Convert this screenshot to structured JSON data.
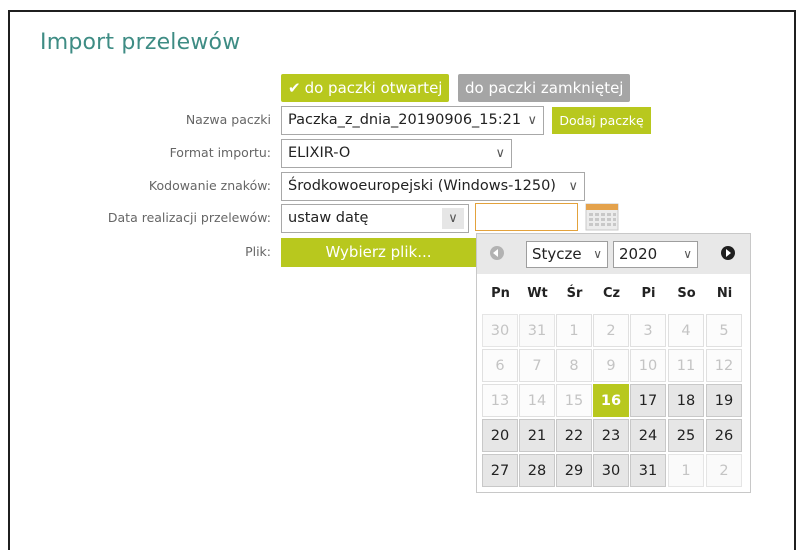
{
  "page": {
    "title": "Import przelewów"
  },
  "target": {
    "open_label": "do paczki otwartej",
    "closed_label": "do paczki zamkniętej",
    "selected": "open"
  },
  "form": {
    "package_name": {
      "label": "Nazwa paczki",
      "value": "Paczka_z_dnia_20190906_15:21",
      "add_label": "Dodaj paczkę"
    },
    "import_format": {
      "label": "Format importu:",
      "value": "ELIXIR-O"
    },
    "encoding": {
      "label": "Kodowanie znaków:",
      "value": "Środkowoeuropejski (Windows-1250)"
    },
    "execution_date": {
      "label": "Data realizacji przelewów:",
      "mode_value": "ustaw datę",
      "date_value": ""
    },
    "file": {
      "label": "Plik:",
      "button_label": "Wybierz plik..."
    }
  },
  "calendar": {
    "month": "Stycze",
    "year": "2020",
    "weekdays": [
      "Pn",
      "Wt",
      "Śr",
      "Cz",
      "Pi",
      "So",
      "Ni"
    ],
    "weeks": [
      [
        {
          "d": "30",
          "s": "off"
        },
        {
          "d": "31",
          "s": "off"
        },
        {
          "d": "1",
          "s": "past"
        },
        {
          "d": "2",
          "s": "past"
        },
        {
          "d": "3",
          "s": "past"
        },
        {
          "d": "4",
          "s": "past"
        },
        {
          "d": "5",
          "s": "past"
        }
      ],
      [
        {
          "d": "6",
          "s": "past"
        },
        {
          "d": "7",
          "s": "past"
        },
        {
          "d": "8",
          "s": "past"
        },
        {
          "d": "9",
          "s": "past"
        },
        {
          "d": "10",
          "s": "past"
        },
        {
          "d": "11",
          "s": "past"
        },
        {
          "d": "12",
          "s": "past"
        }
      ],
      [
        {
          "d": "13",
          "s": "past"
        },
        {
          "d": "14",
          "s": "past"
        },
        {
          "d": "15",
          "s": "past"
        },
        {
          "d": "16",
          "s": "today"
        },
        {
          "d": "17",
          "s": "act"
        },
        {
          "d": "18",
          "s": "act"
        },
        {
          "d": "19",
          "s": "act"
        }
      ],
      [
        {
          "d": "20",
          "s": "act"
        },
        {
          "d": "21",
          "s": "act"
        },
        {
          "d": "22",
          "s": "act"
        },
        {
          "d": "23",
          "s": "act"
        },
        {
          "d": "24",
          "s": "act"
        },
        {
          "d": "25",
          "s": "act"
        },
        {
          "d": "26",
          "s": "act"
        }
      ],
      [
        {
          "d": "27",
          "s": "act"
        },
        {
          "d": "28",
          "s": "act"
        },
        {
          "d": "29",
          "s": "act"
        },
        {
          "d": "30",
          "s": "act"
        },
        {
          "d": "31",
          "s": "act"
        },
        {
          "d": "1",
          "s": "off"
        },
        {
          "d": "2",
          "s": "off"
        }
      ]
    ]
  },
  "colors": {
    "accent_green": "#b8c81e",
    "title_teal": "#3e8c84",
    "inactive_gray": "#a5a5a5",
    "date_focus": "#e3a23c"
  },
  "icons": {
    "check": "check-icon",
    "chevron": "chevron-down-icon",
    "calendar": "calendar-icon",
    "prev": "prev-month-icon",
    "next": "next-month-icon"
  }
}
